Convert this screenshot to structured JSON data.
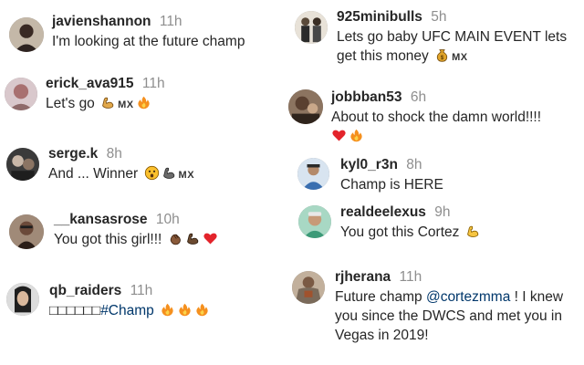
{
  "comments": [
    {
      "username": "javienshannon",
      "time": "11h",
      "lines": [
        "I'm looking at the future champ"
      ],
      "avatar_color": "#3a2a24"
    },
    {
      "username": "erick_ava915",
      "time": "11h",
      "text": "Let's go",
      "flag_text": "MX",
      "emojis": [
        "flexed-biceps",
        "fire"
      ],
      "avatar_color": "#b38a8a"
    },
    {
      "username": "serge.k",
      "time": "8h",
      "text": "And ... Winner",
      "flag_text": "MX",
      "emojis": [
        "astonished-face",
        "flexed-biceps-dark"
      ],
      "avatar_color": "#2d2d2d"
    },
    {
      "username": "__kansasrose",
      "time": "10h",
      "text": "You got this girl!!!",
      "emojis": [
        "clapping-hands",
        "flexed-biceps-dark",
        "red-heart"
      ],
      "avatar_color": "#6b4a3a"
    },
    {
      "username": "qb_raiders",
      "time": "11h",
      "boxes": "□□□□□□",
      "hashtag": "#Champ",
      "emojis": [
        "fire",
        "fire",
        "fire"
      ],
      "avatar_color": "#1f1f1f"
    },
    {
      "username": "925minibulls",
      "time": "5h",
      "lines": [
        "Lets go baby UFC MAIN EVENT lets",
        "get this money"
      ],
      "flag_text": "MX",
      "emojis": [
        "money-bag"
      ],
      "avatar_color": "#9a8a7a"
    },
    {
      "username": "jobbban53",
      "time": "6h",
      "lines": [
        "About to shock the damn world!!!!"
      ],
      "emojis": [
        "red-heart",
        "fire"
      ],
      "avatar_color": "#5a4030"
    },
    {
      "username": "kyl0_r3n",
      "time": "8h",
      "lines": [
        "Champ is HERE"
      ],
      "avatar_color": "#3a6fb0"
    },
    {
      "username": "realdeelexus",
      "time": "9h",
      "text": "You got this Cortez",
      "emojis": [
        "flexed-biceps"
      ],
      "avatar_color": "#3c9a78"
    },
    {
      "username": "rjherana",
      "time": "11h",
      "line1_before": "Future champ",
      "mention": "@cortezmma",
      "line1_after": "! I knew",
      "lines": [
        "you since the DWCS and met you in",
        "Vegas in 2019!"
      ],
      "avatar_color": "#7a6a5a"
    }
  ],
  "colors": {
    "username": "#262626",
    "timestamp": "#8e8e8e",
    "link": "#00376b",
    "fire": "#f5901e",
    "heart": "#e3242b",
    "biceps_light": "#f6c542",
    "biceps_dark": "#5a3d2b"
  }
}
